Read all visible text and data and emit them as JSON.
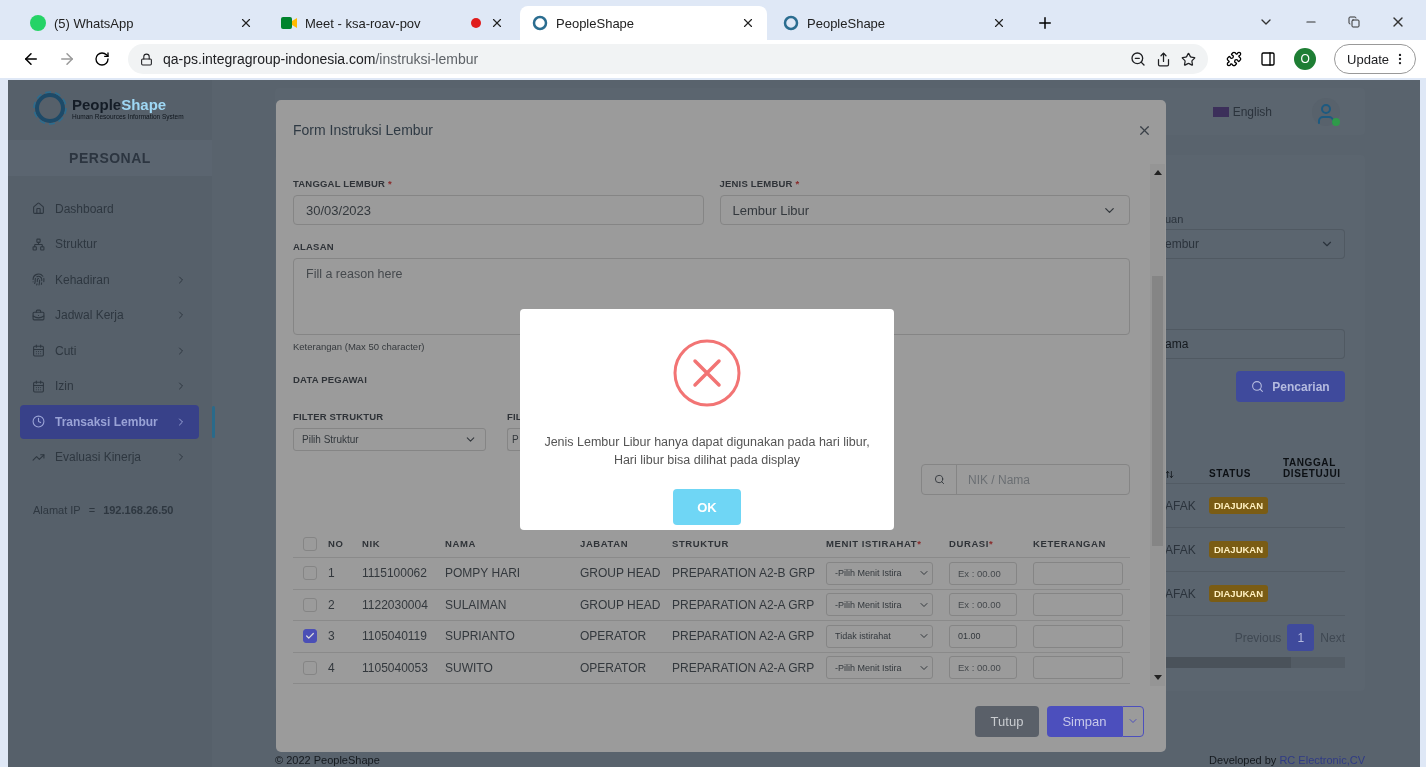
{
  "browser": {
    "tabs": [
      {
        "title": "(5) WhatsApp",
        "kind": "whatsapp",
        "recording": false,
        "selected": false
      },
      {
        "title": "Meet - ksa-roav-pov",
        "kind": "meet",
        "recording": true,
        "selected": false
      },
      {
        "title": "PeopleShape",
        "kind": "peopleshape",
        "recording": false,
        "selected": true
      },
      {
        "title": "PeopleShape",
        "kind": "peopleshape",
        "recording": false,
        "selected": false
      }
    ],
    "url_host": "qa-ps.integragroup-indonesia.com",
    "url_path": "/instruksi-lembur",
    "profile_initial": "O",
    "update_label": "Update"
  },
  "sidebar": {
    "logo_primary": "People",
    "logo_secondary": "Shape",
    "logo_tagline": "Human Resources Information System",
    "section": "PERSONAL",
    "items": [
      {
        "label": "Dashboard",
        "expandable": false,
        "selected": false
      },
      {
        "label": "Struktur",
        "expandable": false,
        "selected": false
      },
      {
        "label": "Kehadiran",
        "expandable": true,
        "selected": false
      },
      {
        "label": "Jadwal Kerja",
        "expandable": true,
        "selected": false
      },
      {
        "label": "Cuti",
        "expandable": true,
        "selected": false
      },
      {
        "label": "Izin",
        "expandable": true,
        "selected": false
      },
      {
        "label": "Transaksi Lembur",
        "expandable": true,
        "selected": true
      },
      {
        "label": "Evaluasi Kinerja",
        "expandable": true,
        "selected": false
      }
    ],
    "ip_label": "Alamat IP",
    "ip_separator": "=",
    "ip_value": "192.168.26.50"
  },
  "topbar": {
    "language": "English",
    "user_online": true
  },
  "page": {
    "filter_label_fragment": "uan",
    "filter_select_fragment": "embur",
    "search_fragment": "ama",
    "search_button": "Pencarian",
    "table": {
      "columns": [
        "STATUS",
        "TANGGAL DISETUJUI"
      ],
      "rows": [
        {
          "name_fragment": "AFAK",
          "status": "DIAJUKAN"
        },
        {
          "name_fragment": "AFAK",
          "status": "DIAJUKAN"
        },
        {
          "name_fragment": "AFAK",
          "status": "DIAJUKAN"
        }
      ]
    },
    "pagination": {
      "previous": "Previous",
      "pages": [
        {
          "label": "1",
          "selected": true
        }
      ],
      "next": "Next"
    }
  },
  "footer": {
    "copyright": "© 2022 PeopleShape",
    "developed_prefix": "Developed by",
    "developed_link": "RC Electronic,CV"
  },
  "modal": {
    "title": "Form Instruksi Lembur",
    "required_mark": "*",
    "date_label": "TANGGAL LEMBUR",
    "date_value": "30/03/2023",
    "type_label": "JENIS LEMBUR",
    "type_value": "Lembur Libur",
    "reason_label": "ALASAN",
    "reason_placeholder": "Fill a reason here",
    "reason_hint": "Keterangan (Max 50 character)",
    "employees_label": "DATA PEGAWAI",
    "filter_label": "FILTER STRUKTUR",
    "filter_placeholder": "Pilih Struktur",
    "filter2_label_fragment": "FIL",
    "filter2_value_fragment": "P",
    "search_placeholder": "NIK / Nama",
    "columns": [
      {
        "label": "NO",
        "required": false
      },
      {
        "label": "NIK",
        "required": false
      },
      {
        "label": "NAMA",
        "required": false
      },
      {
        "label": "JABATAN",
        "required": false
      },
      {
        "label": "STRUKTUR",
        "required": false
      },
      {
        "label": "MENIT ISTIRAHAT",
        "required": true
      },
      {
        "label": "DURASI",
        "required": true
      },
      {
        "label": "KETERANGAN",
        "required": false
      }
    ],
    "all_checked": false,
    "rows": [
      {
        "checked": false,
        "no": "1",
        "nik": "1115100062",
        "nama": "POMPY HARI",
        "jabatan": "GROUP HEAD",
        "struktur": "PREPARATION A2-B GRP",
        "break": "-Pilih Menit Istira",
        "duration": "",
        "duration_placeholder": "Ex : 00.00"
      },
      {
        "checked": false,
        "no": "2",
        "nik": "1122030004",
        "nama": "SULAIMAN",
        "jabatan": "GROUP HEAD",
        "struktur": "PREPARATION A2-A GRP",
        "break": "-Pilih Menit Istira",
        "duration": "",
        "duration_placeholder": "Ex : 00.00"
      },
      {
        "checked": true,
        "no": "3",
        "nik": "1105040119",
        "nama": "SUPRIANTO",
        "jabatan": "OPERATOR",
        "struktur": "PREPARATION A2-A GRP",
        "break": "Tidak istirahat",
        "duration": "01.00"
      },
      {
        "checked": false,
        "no": "4",
        "nik": "1105040053",
        "nama": "SUWITO",
        "jabatan": "OPERATOR",
        "struktur": "PREPARATION A2-A GRP",
        "break": "-Pilih Menit Istira",
        "duration": "",
        "duration_placeholder": "Ex : 00.00"
      }
    ],
    "close_button": "Tutup",
    "save_button": "Simpan"
  },
  "alert": {
    "message_lines": [
      "Jenis Lembur Libur hanya dapat digunakan pada hari libur,",
      "Hari libur bisa dilihat pada display"
    ],
    "ok_button": "OK"
  }
}
